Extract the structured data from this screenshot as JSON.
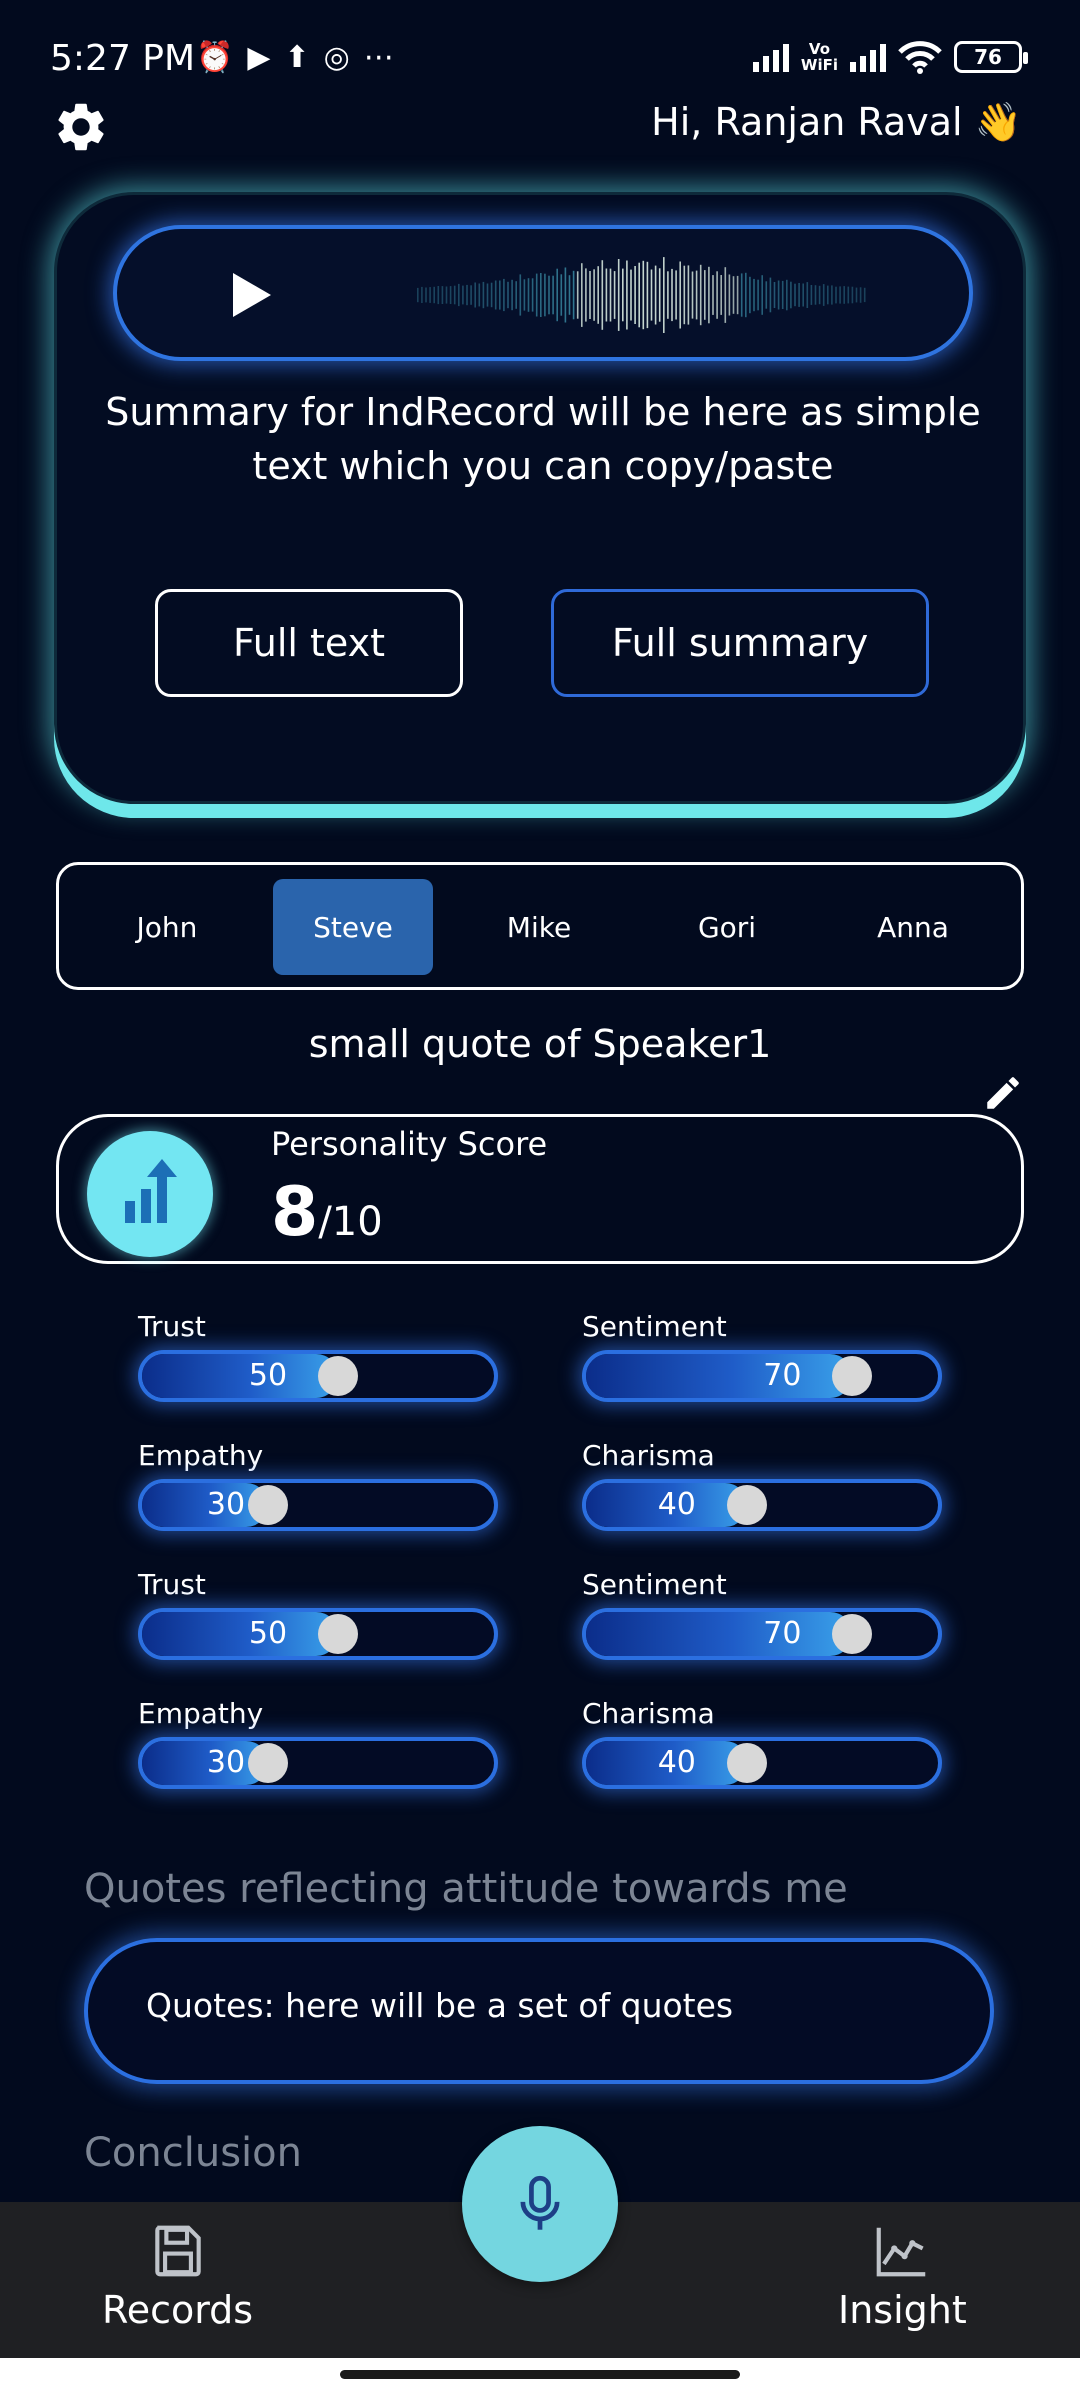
{
  "status_bar": {
    "time": "5:27 PM",
    "vowifi_line1": "Vo",
    "vowifi_line2": "WiFi",
    "battery": "76"
  },
  "header": {
    "greeting": "Hi, Ranjan Raval 👋"
  },
  "summary_card": {
    "summary_text": "Summary for IndRecord will be here as simple text which you can copy/paste",
    "full_text_label": "Full text",
    "full_summary_label": "Full summary"
  },
  "speakers": {
    "tabs": [
      {
        "label": "John"
      },
      {
        "label": "Steve",
        "active": true
      },
      {
        "label": "Mike"
      },
      {
        "label": "Gori"
      },
      {
        "label": "Anna"
      }
    ]
  },
  "speaker_quote": "small quote of Speaker1",
  "personality": {
    "label": "Personality Score",
    "score": "8",
    "max": "/10"
  },
  "metrics": [
    {
      "label": "Trust",
      "value": "50",
      "level": 0.5
    },
    {
      "label": "Sentiment",
      "value": "70",
      "level": 0.7
    },
    {
      "label": "Empathy",
      "value": "30",
      "level": 0.3
    },
    {
      "label": "Charisma",
      "value": "40",
      "level": 0.4
    },
    {
      "label": "Trust",
      "value": "50",
      "level": 0.5
    },
    {
      "label": "Sentiment",
      "value": "70",
      "level": 0.7
    },
    {
      "label": "Empathy",
      "value": "30",
      "level": 0.3
    },
    {
      "label": "Charisma",
      "value": "40",
      "level": 0.4
    }
  ],
  "quotes_section": {
    "title": "Quotes reflecting attitude towards me",
    "text": "Quotes: here will be a set of quotes"
  },
  "conclusion_title": "Conclusion",
  "bottom_nav": {
    "records_label": "Records",
    "insight_label": "Insight"
  },
  "colors": {
    "background": "#020a1e",
    "accent_cyan": "#6ee7ea",
    "accent_blue": "#2b6fe0",
    "active_tab": "#2a64ac"
  }
}
